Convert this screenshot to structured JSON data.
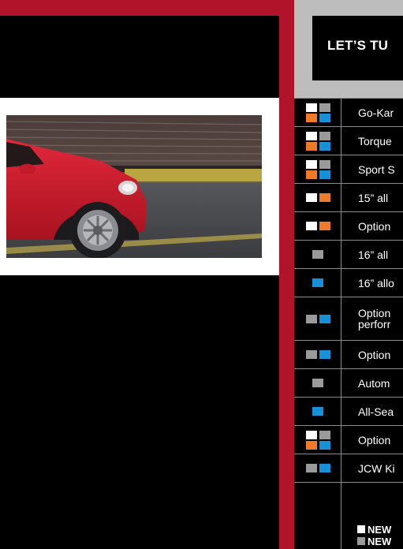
{
  "page": {
    "heading": "LET’S TU",
    "colors": {
      "red": "#b1142a",
      "white": "#ffffff",
      "gray": "#9a9a9a",
      "orange": "#f07a28",
      "blue": "#1690d6"
    }
  },
  "photo": {
    "subject": "red car driving past a pier"
  },
  "features": [
    {
      "label": "Go-Kar",
      "swatches": [
        "white",
        "gray",
        "orange",
        "blue"
      ]
    },
    {
      "label": "Torque",
      "swatches": [
        "white",
        "gray",
        "orange",
        "blue"
      ]
    },
    {
      "label": "Sport S",
      "swatches": [
        "white",
        "gray",
        "orange",
        "blue"
      ]
    },
    {
      "label": "15” all",
      "swatches": [
        "white",
        "orange"
      ]
    },
    {
      "label": "Option",
      "swatches": [
        "white",
        "orange"
      ]
    },
    {
      "label": "16” all",
      "swatches": [
        "gray"
      ]
    },
    {
      "label": "16” allo",
      "swatches": [
        "blue"
      ]
    },
    {
      "label": "Option",
      "label2": "perforr",
      "swatches": [
        "gray",
        "blue"
      ]
    },
    {
      "label": "Option",
      "swatches": [
        "gray",
        "blue"
      ]
    },
    {
      "label": "Autom",
      "swatches": [
        "gray"
      ]
    },
    {
      "label": "All-Sea",
      "swatches": [
        "blue"
      ]
    },
    {
      "label": "Option",
      "swatches": [
        "white",
        "gray",
        "orange",
        "blue"
      ]
    },
    {
      "label": "JCW Ki",
      "swatches": [
        "gray",
        "blue"
      ]
    }
  ],
  "legend": [
    {
      "text": "NEW",
      "color": "white"
    },
    {
      "text": "NEW",
      "color": "gray"
    }
  ]
}
